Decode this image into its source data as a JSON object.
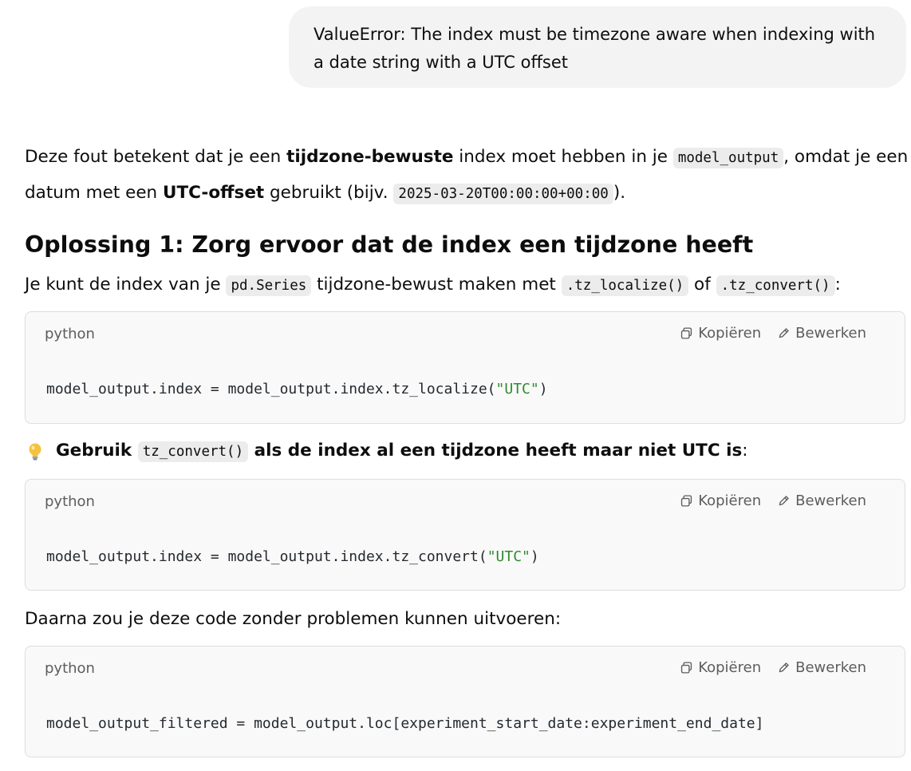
{
  "user_message": {
    "text": "ValueError: The index must be timezone aware when indexing with a date string with a UTC offset"
  },
  "answer": {
    "para1": {
      "t1": "Deze fout betekent dat je een ",
      "b1": "tijdzone-bewuste",
      "t2": " index moet hebben in je ",
      "c1": "model_output",
      "t3": ", omdat je een datum met een ",
      "b2": "UTC-offset",
      "t4": " gebruikt (bijv. ",
      "c2": "2025-03-20T00:00:00+00:00",
      "t5": ")."
    },
    "heading": "Oplossing 1: Zorg ervoor dat de index een tijdzone heeft",
    "para2": {
      "t1": "Je kunt de index van je ",
      "c1": "pd.Series",
      "t2": " tijdzone-bewust maken met ",
      "c2": ".tz_localize()",
      "t3": " of ",
      "c3": ".tz_convert()",
      "t4": ":"
    },
    "tip": {
      "icon": "lightbulb-icon",
      "b1": "Gebruik ",
      "c1": "tz_convert()",
      "b2": " als de index al een tijdzone heeft maar niet UTC is",
      "t1": ":"
    },
    "para3": "Daarna zou je deze code zonder problemen kunnen uitvoeren:"
  },
  "code_blocks": [
    {
      "language": "python",
      "copy_label": "Kopiëren",
      "edit_label": "Bewerken",
      "code_pre": "model_output.index = model_output.index.tz_localize(",
      "code_str": "\"UTC\"",
      "code_post": ")"
    },
    {
      "language": "python",
      "copy_label": "Kopiëren",
      "edit_label": "Bewerken",
      "code_pre": "model_output.index = model_output.index.tz_convert(",
      "code_str": "\"UTC\"",
      "code_post": ")"
    },
    {
      "language": "python",
      "copy_label": "Kopiëren",
      "edit_label": "Bewerken",
      "code_pre": "model_output_filtered = model_output.loc[experiment_start_date:experiment_end_date]",
      "code_str": "",
      "code_post": ""
    }
  ],
  "colors": {
    "bubble_bg": "#f3f3f3",
    "code_bg": "#f9f9f9",
    "string_green": "#2e8b2e"
  }
}
